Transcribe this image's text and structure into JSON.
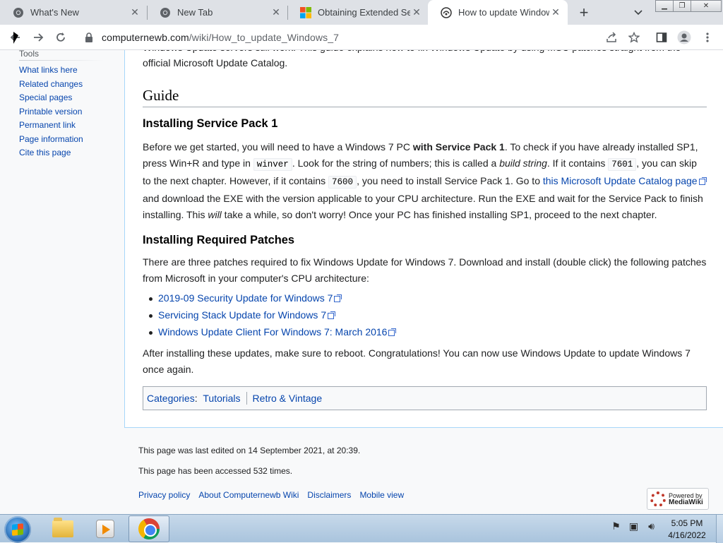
{
  "tabs": [
    {
      "title": "What's New",
      "favicon": "chrome-icon",
      "active": false
    },
    {
      "title": "New Tab",
      "favicon": "chrome-icon",
      "active": false
    },
    {
      "title": "Obtaining Extended Secu",
      "favicon": "microsoft-icon",
      "active": false
    },
    {
      "title": "How to update Windows",
      "favicon": "computernewb-icon",
      "active": true
    }
  ],
  "toolbar": {
    "url_host": "computernewb.com",
    "url_path": "/wiki/How_to_update_Windows_7"
  },
  "sidebar": {
    "heading": "Tools",
    "items": [
      "What links here",
      "Related changes",
      "Special pages",
      "Printable version",
      "Permanent link",
      "Page information",
      "Cite this page"
    ]
  },
  "article": {
    "clipped_top": "Windows Update servers still work. This guide explains how to fix Windows Update by using MSU patches straight from the",
    "intro_end": "official Microsoft Update Catalog.",
    "guide_heading": "Guide",
    "sp1_heading": "Installing Service Pack 1",
    "sp1": {
      "t1": "Before we get started, you will need to have a Windows 7 PC ",
      "b1": "with Service Pack 1",
      "t2": ". To check if you have already installed SP1, press Win+R and type in ",
      "c1": "winver",
      "t3": ". Look for the string of numbers; this is called a ",
      "i1": "build string",
      "t4": ". If it contains ",
      "c2": "7601",
      "t5": ", you can skip to the next chapter. However, if it contains ",
      "c3": "7600",
      "t6": ", you need to install Service Pack 1. Go to ",
      "link": "this Microsoft Update Catalog page",
      "t7": " and download the EXE with the version applicable to your CPU architecture. Run the EXE and wait for the Service Pack to finish installing. This ",
      "i2": "will",
      "t8": " take a while, so don't worry! Once your PC has finished installing SP1, proceed to the next chapter."
    },
    "patches_heading": "Installing Required Patches",
    "patches_intro": "There are three patches required to fix Windows Update for Windows 7. Download and install (double click) the following patches from Microsoft in your computer's CPU architecture:",
    "patches": [
      "2019-09 Security Update for Windows 7",
      "Servicing Stack Update for Windows 7",
      "Windows Update Client For Windows 7: March 2016"
    ],
    "outro": "After installing these updates, make sure to reboot. Congratulations! You can now use Windows Update to update Windows 7 once again.",
    "categories_label": "Categories",
    "categories": [
      "Tutorials",
      "Retro & Vintage"
    ]
  },
  "footer": {
    "last_edited": "This page was last edited on 14 September 2021, at 20:39.",
    "accessed": "This page has been accessed 532 times.",
    "links": [
      "Privacy policy",
      "About Computernewb Wiki",
      "Disclaimers",
      "Mobile view"
    ],
    "badge_line1": "Powered by",
    "badge_line2": "MediaWiki"
  },
  "taskbar": {
    "time": "5:05 PM",
    "date": "4/16/2022",
    "apps": [
      "explorer-icon",
      "media-player-icon",
      "chrome-icon"
    ]
  },
  "colors": {
    "link": "#0645ad",
    "content_border": "#a7d7f9",
    "tabstrip": "#dee1e6"
  }
}
